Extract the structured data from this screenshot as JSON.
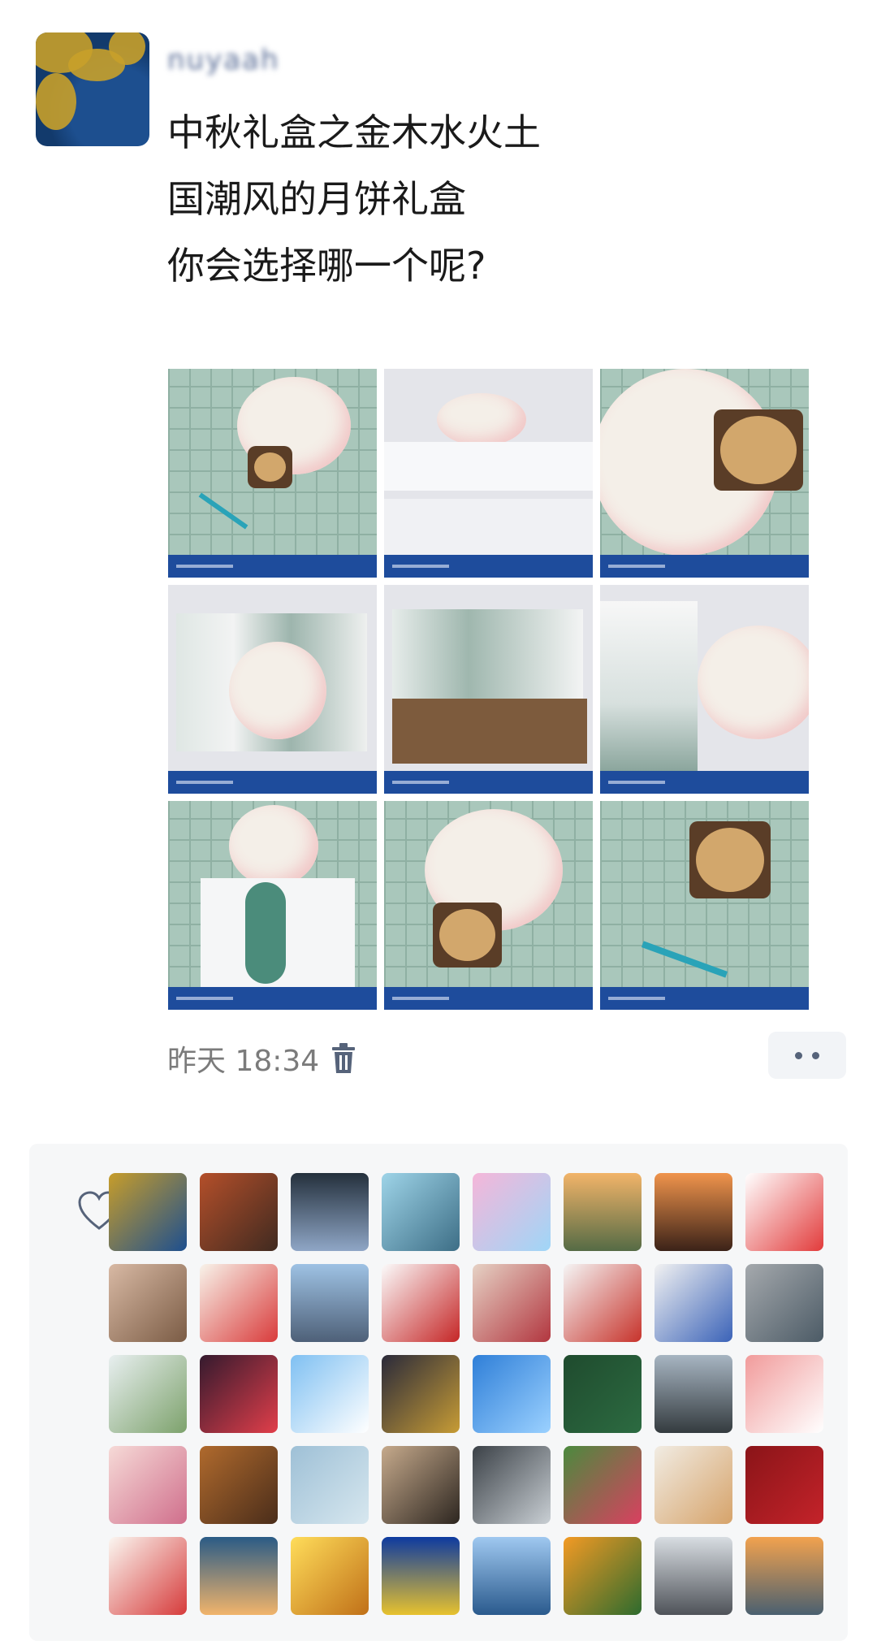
{
  "author": {
    "name": "nuyaah",
    "avatar": "author-avatar"
  },
  "post": {
    "lines": [
      "中秋礼盒之金木水火土",
      "国潮风的月饼礼盒",
      "你会选择哪一个呢?"
    ],
    "photo_count": 9
  },
  "meta": {
    "time": "昨天 18:34",
    "delete_icon": "trash-icon",
    "more_icon": "more-dots-icon"
  },
  "likes": {
    "icon": "heart-icon",
    "avatar_count": 40
  },
  "colors": {
    "name_blue": "#576b95",
    "photo_band": "#1e4c9c",
    "panel_bg": "#f6f7f8"
  }
}
